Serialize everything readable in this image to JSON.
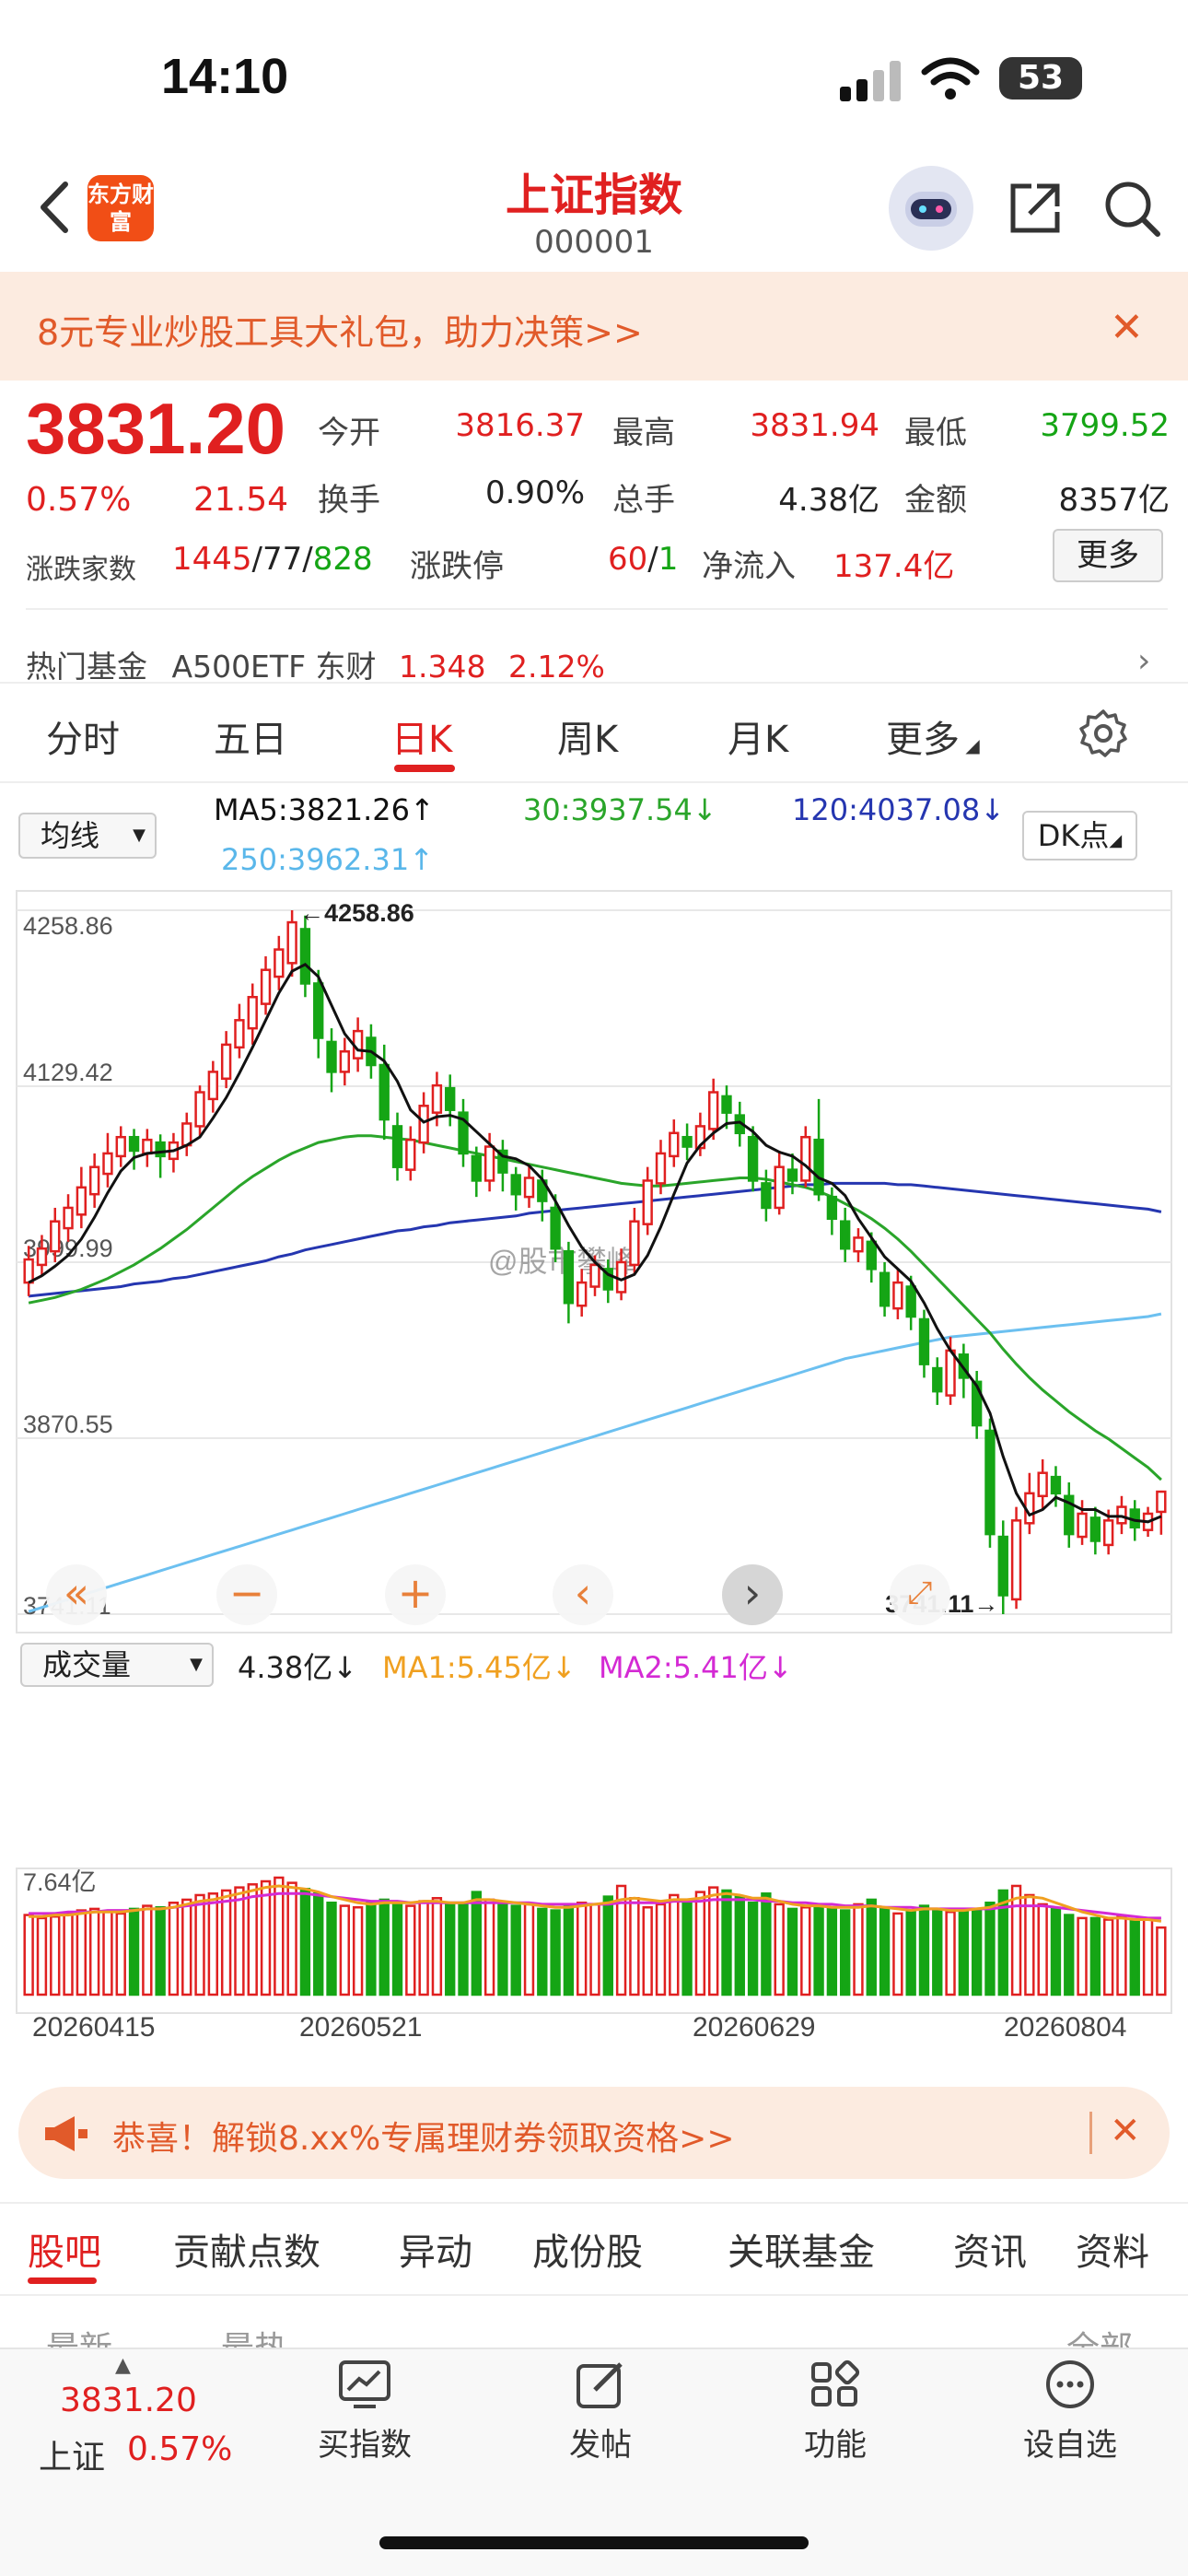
{
  "status": {
    "time": "14:10",
    "battery": "53"
  },
  "header": {
    "logo_text": "东方财富",
    "title": "上证指数",
    "code": "000001"
  },
  "promo": {
    "text": "8元专业炒股工具大礼包，助力决策>>"
  },
  "quote": {
    "price": "3831.20",
    "pct": "0.57%",
    "chg": "21.54",
    "open_label": "今开",
    "open": "3816.37",
    "high_label": "最高",
    "high": "3831.94",
    "low_label": "最低",
    "low": "3799.52",
    "turnover_label": "换手",
    "turnover": "0.90%",
    "volume_label": "总手",
    "volume": "4.38亿",
    "amount_label": "金额",
    "amount": "8357亿",
    "breadth_label": "涨跌家数",
    "up_count": "1445",
    "flat_count": "77",
    "down_count": "828",
    "limit_label": "涨跌停",
    "limit_up": "60",
    "limit_down": "1",
    "netflow_label": "净流入",
    "netflow": "137.4亿",
    "more_label": "更多"
  },
  "hot_fund": {
    "label": "热门基金",
    "name": "A500ETF 东财",
    "price": "1.348",
    "pct": "2.12%"
  },
  "ktabs": [
    "分时",
    "五日",
    "日K",
    "周K",
    "月K",
    "更多"
  ],
  "ma_row": {
    "select_label": "均线",
    "ma5": "MA5:3821.26↑",
    "ma30": "30:3937.54↓",
    "ma120": "120:4037.08↓",
    "ma250": "250:3962.31↑",
    "dk_label": "DK点"
  },
  "chart_labels": {
    "y_ticks": [
      "4258.86",
      "4129.42",
      "3999.99",
      "3870.55",
      "3741.11"
    ],
    "high_marker": "←4258.86",
    "low_marker": "3741.11→",
    "watermark": "@股市攀峰",
    "x_ticks": [
      "20260415",
      "20260521",
      "20260629",
      "20260804"
    ],
    "vol_max": "7.64亿"
  },
  "vol_row": {
    "select_label": "成交量",
    "vol": "4.38亿↓",
    "ma1": "MA1:5.45亿↓",
    "ma2": "MA2:5.41亿↓"
  },
  "colors": {
    "up": "#e02020",
    "down": "#15a515",
    "ma5": "#111111",
    "ma30": "#2aa52a",
    "ma120": "#2536b0",
    "ma250": "#6cc0f0"
  },
  "chart_data": {
    "type": "candlestick",
    "x_range": [
      "20260415",
      "20260804"
    ],
    "ylim": [
      3741.11,
      4258.86
    ],
    "candles": [
      [
        3985,
        4002,
        3975,
        4012
      ],
      [
        3998,
        4010,
        3990,
        4020
      ],
      [
        4008,
        4030,
        4000,
        4040
      ],
      [
        4025,
        4040,
        4015,
        4050
      ],
      [
        4035,
        4055,
        4025,
        4070
      ],
      [
        4050,
        4070,
        4040,
        4080
      ],
      [
        4065,
        4080,
        4055,
        4095
      ],
      [
        4078,
        4092,
        4070,
        4100
      ],
      [
        4092,
        4082,
        4068,
        4098
      ],
      [
        4080,
        4090,
        4070,
        4098
      ],
      [
        4088,
        4078,
        4062,
        4094
      ],
      [
        4076,
        4088,
        4066,
        4095
      ],
      [
        4086,
        4102,
        4078,
        4110
      ],
      [
        4100,
        4125,
        4092,
        4130
      ],
      [
        4120,
        4140,
        4110,
        4148
      ],
      [
        4135,
        4160,
        4128,
        4170
      ],
      [
        4158,
        4178,
        4150,
        4190
      ],
      [
        4172,
        4195,
        4160,
        4205
      ],
      [
        4190,
        4215,
        4182,
        4225
      ],
      [
        4210,
        4230,
        4200,
        4240
      ],
      [
        4220,
        4250,
        4210,
        4258.86
      ],
      [
        4245,
        4205,
        4195,
        4255
      ],
      [
        4205,
        4165,
        4150,
        4215
      ],
      [
        4162,
        4140,
        4125,
        4172
      ],
      [
        4140,
        4155,
        4130,
        4165
      ],
      [
        4150,
        4170,
        4140,
        4180
      ],
      [
        4165,
        4145,
        4135,
        4175
      ],
      [
        4145,
        4105,
        4090,
        4160
      ],
      [
        4100,
        4070,
        4060,
        4110
      ],
      [
        4068,
        4090,
        4060,
        4100
      ],
      [
        4088,
        4115,
        4080,
        4125
      ],
      [
        4110,
        4130,
        4100,
        4140
      ],
      [
        4128,
        4112,
        4100,
        4138
      ],
      [
        4110,
        4080,
        4070,
        4120
      ],
      [
        4078,
        4060,
        4048,
        4085
      ],
      [
        4060,
        4085,
        4052,
        4095
      ],
      [
        4082,
        4066,
        4052,
        4090
      ],
      [
        4064,
        4050,
        4038,
        4070
      ],
      [
        4048,
        4062,
        4040,
        4072
      ],
      [
        4060,
        4045,
        4030,
        4068
      ],
      [
        4040,
        4010,
        4000,
        4050
      ],
      [
        4008,
        3970,
        3955,
        4015
      ],
      [
        3968,
        3985,
        3960,
        3995
      ],
      [
        3982,
        3998,
        3975,
        4005
      ],
      [
        3995,
        3980,
        3970,
        4002
      ],
      [
        3978,
        4000,
        3972,
        4010
      ],
      [
        3998,
        4030,
        3992,
        4040
      ],
      [
        4028,
        4060,
        4020,
        4070
      ],
      [
        4058,
        4080,
        4050,
        4090
      ],
      [
        4078,
        4095,
        4070,
        4105
      ],
      [
        4092,
        4085,
        4075,
        4102
      ],
      [
        4084,
        4100,
        4078,
        4110
      ],
      [
        4098,
        4125,
        4090,
        4135
      ],
      [
        4122,
        4110,
        4098,
        4130
      ],
      [
        4108,
        4095,
        4085,
        4118
      ],
      [
        4092,
        4060,
        4052,
        4100
      ],
      [
        4058,
        4040,
        4030,
        4068
      ],
      [
        4040,
        4070,
        4035,
        4082
      ],
      [
        4068,
        4060,
        4050,
        4080
      ],
      [
        4060,
        4092,
        4055,
        4100
      ],
      [
        4090,
        4050,
        4045,
        4120
      ],
      [
        4048,
        4032,
        4020,
        4055
      ],
      [
        4030,
        4010,
        4000,
        4040
      ],
      [
        4008,
        4018,
        4000,
        4025
      ],
      [
        4015,
        3995,
        3985,
        4022
      ],
      [
        3992,
        3968,
        3960,
        4000
      ],
      [
        3966,
        3985,
        3958,
        3995
      ],
      [
        3982,
        3960,
        3950,
        3990
      ],
      [
        3958,
        3925,
        3915,
        3965
      ],
      [
        3922,
        3905,
        3895,
        3930
      ],
      [
        3902,
        3935,
        3895,
        3945
      ],
      [
        3932,
        3915,
        3900,
        3940
      ],
      [
        3912,
        3880,
        3870,
        3920
      ],
      [
        3876,
        3800,
        3790,
        3885
      ],
      [
        3798,
        3755,
        3741.11,
        3810
      ],
      [
        3752,
        3810,
        3745,
        3820
      ],
      [
        3808,
        3830,
        3800,
        3845
      ],
      [
        3828,
        3845,
        3818,
        3855
      ],
      [
        3842,
        3830,
        3820,
        3850
      ],
      [
        3828,
        3800,
        3790,
        3838
      ],
      [
        3798,
        3815,
        3792,
        3825
      ],
      [
        3812,
        3795,
        3785,
        3820
      ],
      [
        3792,
        3810,
        3785,
        3818
      ],
      [
        3808,
        3820,
        3800,
        3828
      ],
      [
        3818,
        3805,
        3795,
        3825
      ],
      [
        3803,
        3815,
        3798,
        3820
      ],
      [
        3816.37,
        3831.2,
        3799.52,
        3831.94
      ]
    ],
    "ma5": [
      3985,
      3990,
      3997,
      4005,
      4017,
      4033,
      4051,
      4067,
      4077,
      4080,
      4081,
      4082,
      4086,
      4092,
      4106,
      4121,
      4139,
      4158,
      4178,
      4198,
      4214,
      4219,
      4210,
      4189,
      4168,
      4156,
      4155,
      4148,
      4133,
      4112,
      4103,
      4107,
      4108,
      4105,
      4096,
      4087,
      4078,
      4076,
      4071,
      4061,
      4045,
      4027,
      4011,
      4000,
      3991,
      3987,
      3991,
      4005,
      4026,
      4050,
      4073,
      4086,
      4095,
      4102,
      4103,
      4096,
      4086,
      4081,
      4078,
      4071,
      4062,
      4058,
      4049,
      4032,
      4018,
      4004,
      3995,
      3986,
      3970,
      3951,
      3935,
      3922,
      3909,
      3889,
      3857,
      3830,
      3814,
      3818,
      3827,
      3823,
      3818,
      3818,
      3813,
      3813,
      3810,
      3809,
      3813
    ],
    "ma30_approx": [
      3970,
      3972,
      3974,
      3977,
      3980,
      3984,
      3988,
      3993,
      3998,
      4004,
      4010,
      4017,
      4024,
      4032,
      4040,
      4048,
      4056,
      4063,
      4069,
      4075,
      4080,
      4084,
      4088,
      4090,
      4092,
      4093,
      4093,
      4092,
      4091,
      4090,
      4088,
      4086,
      4084,
      4082,
      4080,
      4078,
      4076,
      4074,
      4072,
      4070,
      4068,
      4066,
      4064,
      4062,
      4060,
      4058,
      4057,
      4056,
      4056,
      4057,
      4058,
      4059,
      4060,
      4061,
      4062,
      4062,
      4061,
      4059,
      4057,
      4055,
      4052,
      4048,
      4043,
      4038,
      4032,
      4025,
      4017,
      4008,
      3998,
      3988,
      3978,
      3968,
      3958,
      3948,
      3936,
      3925,
      3915,
      3906,
      3898,
      3890,
      3883,
      3876,
      3870,
      3863,
      3856,
      3849,
      3840
    ],
    "ma120_approx": [
      3975,
      3976,
      3977,
      3978,
      3979,
      3980,
      3981,
      3982,
      3984,
      3985,
      3986,
      3988,
      3989,
      3991,
      3993,
      3995,
      3997,
      3999,
      4001,
      4004,
      4006,
      4009,
      4011,
      4013,
      4015,
      4017,
      4019,
      4021,
      4023,
      4024,
      4026,
      4027,
      4029,
      4030,
      4031,
      4032,
      4033,
      4034,
      4036,
      4037,
      4038,
      4039,
      4040,
      4041,
      4042,
      4043,
      4044,
      4045,
      4046,
      4047,
      4048,
      4049,
      4050,
      4051,
      4052,
      4053,
      4054,
      4055,
      4056,
      4057,
      4057,
      4058,
      4058,
      4058,
      4058,
      4058,
      4057,
      4057,
      4056,
      4055,
      4054,
      4053,
      4052,
      4051,
      4050,
      4049,
      4048,
      4047,
      4046,
      4045,
      4044,
      4043,
      4042,
      4041,
      4040,
      4039,
      4037
    ],
    "ma250_approx": [
      3743,
      3746,
      3749,
      3752,
      3755,
      3758,
      3761,
      3764,
      3767,
      3770,
      3773,
      3776,
      3779,
      3782,
      3785,
      3788,
      3791,
      3794,
      3797,
      3800,
      3803,
      3806,
      3809,
      3812,
      3815,
      3818,
      3821,
      3824,
      3827,
      3830,
      3833,
      3836,
      3839,
      3842,
      3845,
      3848,
      3851,
      3854,
      3857,
      3860,
      3863,
      3866,
      3869,
      3872,
      3875,
      3878,
      3881,
      3884,
      3887,
      3890,
      3893,
      3896,
      3899,
      3902,
      3905,
      3908,
      3911,
      3914,
      3917,
      3920,
      3923,
      3926,
      3929,
      3931,
      3933,
      3935,
      3937,
      3939,
      3941,
      3943,
      3945,
      3946,
      3947,
      3948,
      3949,
      3950,
      3951,
      3952,
      3953,
      3954,
      3955,
      3956,
      3957,
      3958,
      3959,
      3960,
      3962
    ],
    "volume_ylim": [
      0,
      7.64
    ],
    "volume": [
      5.2,
      5.0,
      5.1,
      5.3,
      5.5,
      5.6,
      5.4,
      5.3,
      5.6,
      5.8,
      5.7,
      6.0,
      6.2,
      6.5,
      6.6,
      6.8,
      7.0,
      7.2,
      7.4,
      7.64,
      7.3,
      6.9,
      6.6,
      6.0,
      5.8,
      5.7,
      6.0,
      6.2,
      5.9,
      5.8,
      6.1,
      6.3,
      5.9,
      6.0,
      6.7,
      6.2,
      6.0,
      5.8,
      5.9,
      5.6,
      5.5,
      5.8,
      6.0,
      5.9,
      6.4,
      7.1,
      6.3,
      5.7,
      5.9,
      6.5,
      6.2,
      6.7,
      7.0,
      6.8,
      6.4,
      6.0,
      6.6,
      5.9,
      5.6,
      5.7,
      5.9,
      5.7,
      5.5,
      5.9,
      6.2,
      5.6,
      5.3,
      5.5,
      5.8,
      5.6,
      5.4,
      5.5,
      5.6,
      6.0,
      6.8,
      7.1,
      6.5,
      5.9,
      5.6,
      5.2,
      5.0,
      5.0,
      4.9,
      5.1,
      4.8,
      4.9,
      4.38
    ],
    "vol_ma1_approx": [
      5.1,
      5.1,
      5.2,
      5.2,
      5.3,
      5.4,
      5.4,
      5.4,
      5.5,
      5.6,
      5.6,
      5.7,
      5.9,
      6.1,
      6.2,
      6.4,
      6.6,
      6.8,
      7.0,
      7.1,
      7.0,
      6.9,
      6.7,
      6.4,
      6.2,
      6.0,
      5.9,
      6.0,
      6.0,
      6.0,
      6.1,
      6.1,
      6.0,
      6.0,
      6.2,
      6.2,
      6.1,
      6.0,
      5.9,
      5.8,
      5.7,
      5.7,
      5.8,
      5.9,
      6.0,
      6.2,
      6.3,
      6.2,
      6.1,
      6.2,
      6.2,
      6.3,
      6.5,
      6.6,
      6.5,
      6.3,
      6.3,
      6.1,
      5.9,
      5.8,
      5.8,
      5.7,
      5.7,
      5.7,
      5.8,
      5.7,
      5.6,
      5.5,
      5.6,
      5.6,
      5.5,
      5.5,
      5.6,
      5.7,
      6.0,
      6.3,
      6.4,
      6.3,
      6.0,
      5.7,
      5.4,
      5.2,
      5.0,
      5.0,
      4.9,
      4.9,
      4.8
    ],
    "vol_ma2_approx": [
      5.3,
      5.3,
      5.3,
      5.4,
      5.4,
      5.4,
      5.5,
      5.5,
      5.5,
      5.6,
      5.6,
      5.7,
      5.8,
      5.9,
      6.0,
      6.1,
      6.2,
      6.4,
      6.5,
      6.6,
      6.6,
      6.6,
      6.5,
      6.4,
      6.3,
      6.2,
      6.1,
      6.1,
      6.1,
      6.0,
      6.0,
      6.0,
      6.0,
      6.0,
      6.0,
      6.0,
      6.0,
      6.0,
      6.0,
      5.9,
      5.9,
      5.9,
      5.9,
      5.9,
      5.9,
      6.0,
      6.0,
      6.0,
      6.0,
      6.1,
      6.1,
      6.1,
      6.2,
      6.2,
      6.2,
      6.2,
      6.1,
      6.1,
      6.0,
      6.0,
      5.9,
      5.9,
      5.8,
      5.8,
      5.8,
      5.7,
      5.7,
      5.7,
      5.6,
      5.6,
      5.6,
      5.6,
      5.6,
      5.6,
      5.7,
      5.8,
      5.8,
      5.8,
      5.7,
      5.6,
      5.5,
      5.4,
      5.3,
      5.2,
      5.1,
      5.0,
      5.0
    ]
  },
  "promo2": {
    "text": "恭喜！解锁8.xx%专属理财券领取资格>>"
  },
  "subtabs": [
    "股吧",
    "贡献点数",
    "异动",
    "成份股",
    "关联基金",
    "资讯",
    "资料"
  ],
  "sub_partial": {
    "left": "最新",
    "mid": "最热",
    "right": "全部"
  },
  "bottombar": {
    "price": "3831.20",
    "name": "上证",
    "pct": "0.57%",
    "buy_label": "买指数",
    "post_label": "发帖",
    "func_label": "功能",
    "fav_label": "设自选"
  }
}
